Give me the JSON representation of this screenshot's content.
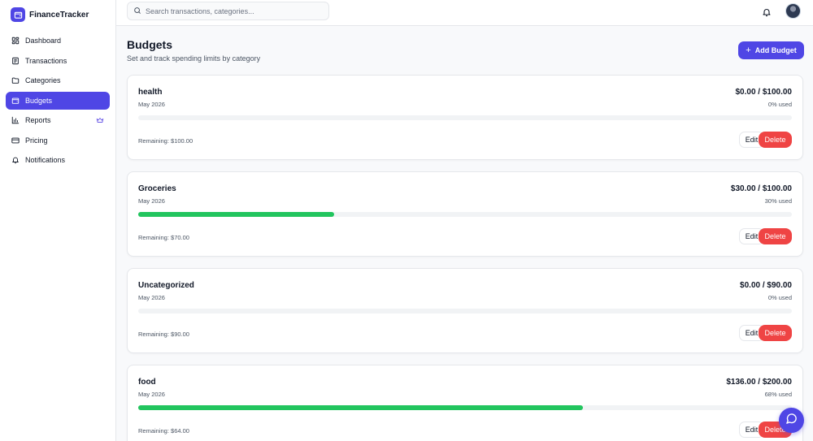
{
  "app": {
    "name": "FinanceTracker"
  },
  "sidebar": {
    "items": [
      {
        "label": "Dashboard",
        "icon": "dashboard-grid-icon"
      },
      {
        "label": "Transactions",
        "icon": "receipt-icon"
      },
      {
        "label": "Categories",
        "icon": "folder-icon"
      },
      {
        "label": "Budgets",
        "icon": "wallet-icon",
        "active": true
      },
      {
        "label": "Reports",
        "icon": "bar-chart-icon",
        "premium_icon": "crown-icon"
      },
      {
        "label": "Pricing",
        "icon": "credit-card-icon"
      },
      {
        "label": "Notifications",
        "icon": "bell-icon"
      }
    ]
  },
  "header": {
    "search_placeholder": "Search transactions, categories..."
  },
  "page": {
    "title": "Budgets",
    "subtitle": "Set and track spending limits by category",
    "add_button": "Add Budget"
  },
  "budgets": [
    {
      "name": "health",
      "period": "May 2026",
      "amount": "$0.00 / $100.00",
      "used_text": "0% used",
      "used_fraction": 0.0,
      "remaining": "Remaining: $100.00",
      "edit": "Edit",
      "delete": "Delete"
    },
    {
      "name": "Groceries",
      "period": "May 2026",
      "amount": "$30.00 / $100.00",
      "used_text": "30% used",
      "used_fraction": 0.3,
      "remaining": "Remaining: $70.00",
      "edit": "Edit",
      "delete": "Delete"
    },
    {
      "name": "Uncategorized",
      "period": "May 2026",
      "amount": "$0.00 / $90.00",
      "used_text": "0% used",
      "used_fraction": 0.0,
      "remaining": "Remaining: $90.00",
      "edit": "Edit",
      "delete": "Delete"
    },
    {
      "name": "food",
      "period": "May 2026",
      "amount": "$136.00 / $200.00",
      "used_text": "68% used",
      "used_fraction": 0.68,
      "remaining": "Remaining: $64.00",
      "edit": "Edit",
      "delete": "Delete"
    }
  ],
  "colors": {
    "accent": "#4f46e5",
    "progress": "#22c55e",
    "danger": "#ef4444"
  }
}
